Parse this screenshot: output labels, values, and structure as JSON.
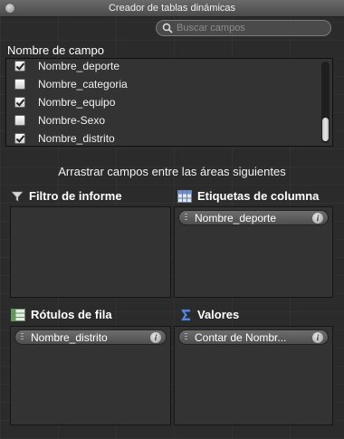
{
  "window": {
    "title": "Creador de tablas dinámicas"
  },
  "search": {
    "placeholder": "Buscar campos"
  },
  "field_list": {
    "heading": "Nombre de campo",
    "fields": [
      {
        "label": "Nombre_deporte",
        "checked": true
      },
      {
        "label": "Nombre_categoria",
        "checked": false
      },
      {
        "label": "Nombre_equipo",
        "checked": true
      },
      {
        "label": "Nombre-Sexo",
        "checked": false
      },
      {
        "label": "Nombre_distrito",
        "checked": true
      }
    ]
  },
  "drag_hint": "Arrastrar campos entre las áreas siguientes",
  "areas": {
    "report_filter": {
      "title": "Filtro de informe",
      "icon": "filter-icon",
      "items": []
    },
    "column_labels": {
      "title": "Etiquetas de columna",
      "icon": "column-table-icon",
      "items": [
        "Nombre_deporte"
      ]
    },
    "row_labels": {
      "title": "Rótulos de fila",
      "icon": "row-table-icon",
      "items": [
        "Nombre_distrito"
      ]
    },
    "values": {
      "title": "Valores",
      "icon": "sigma-icon",
      "items": [
        "Contar de Nombr..."
      ]
    }
  },
  "info_glyph": "i"
}
